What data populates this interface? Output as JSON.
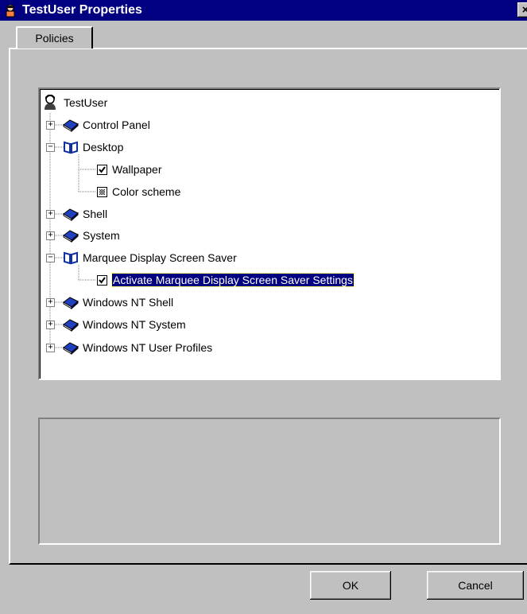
{
  "window": {
    "title": "TestUser Properties",
    "close_symbol": "×"
  },
  "tabs": [
    {
      "label": "Policies",
      "active": true
    }
  ],
  "tree": {
    "root": {
      "label": "TestUser",
      "icon": "user-icon"
    },
    "items": [
      {
        "label": "Control Panel",
        "type": "book",
        "expanded": false
      },
      {
        "label": "Desktop",
        "type": "book",
        "expanded": true
      },
      {
        "label": "Wallpaper",
        "type": "checkbox",
        "state": "checked"
      },
      {
        "label": "Color scheme",
        "type": "checkbox",
        "state": "indeterminate"
      },
      {
        "label": "Shell",
        "type": "book",
        "expanded": false
      },
      {
        "label": "System",
        "type": "book",
        "expanded": false
      },
      {
        "label": "Marquee Display Screen Saver",
        "type": "book",
        "expanded": true
      },
      {
        "label": "Activate Marquee Display Screen Saver Settings",
        "type": "checkbox",
        "state": "checked",
        "selected": true
      },
      {
        "label": "Windows NT Shell",
        "type": "book",
        "expanded": false
      },
      {
        "label": "Windows NT System",
        "type": "book",
        "expanded": false
      },
      {
        "label": "Windows NT User Profiles",
        "type": "book",
        "expanded": false
      }
    ]
  },
  "buttons": {
    "ok": "OK",
    "cancel": "Cancel"
  },
  "colors": {
    "titlebar": "#000080",
    "selection": "#000080",
    "face": "#c0c0c0",
    "book": "#1f3fb0"
  }
}
